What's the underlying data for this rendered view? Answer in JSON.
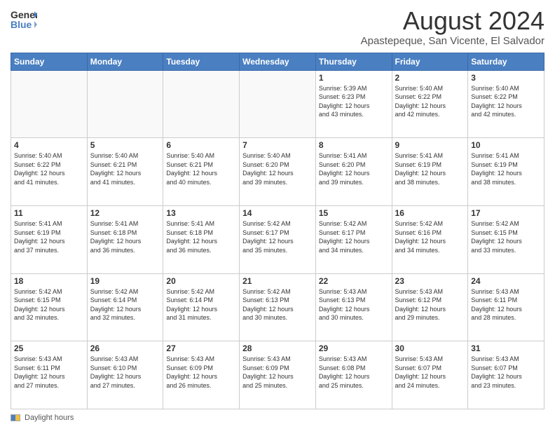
{
  "logo": {
    "line1": "General",
    "line2": "Blue"
  },
  "title": "August 2024",
  "location": "Apastepeque, San Vicente, El Salvador",
  "days_of_week": [
    "Sunday",
    "Monday",
    "Tuesday",
    "Wednesday",
    "Thursday",
    "Friday",
    "Saturday"
  ],
  "footer": {
    "label": "Daylight hours"
  },
  "weeks": [
    [
      {
        "day": "",
        "info": ""
      },
      {
        "day": "",
        "info": ""
      },
      {
        "day": "",
        "info": ""
      },
      {
        "day": "",
        "info": ""
      },
      {
        "day": "1",
        "info": "Sunrise: 5:39 AM\nSunset: 6:23 PM\nDaylight: 12 hours\nand 43 minutes."
      },
      {
        "day": "2",
        "info": "Sunrise: 5:40 AM\nSunset: 6:22 PM\nDaylight: 12 hours\nand 42 minutes."
      },
      {
        "day": "3",
        "info": "Sunrise: 5:40 AM\nSunset: 6:22 PM\nDaylight: 12 hours\nand 42 minutes."
      }
    ],
    [
      {
        "day": "4",
        "info": "Sunrise: 5:40 AM\nSunset: 6:22 PM\nDaylight: 12 hours\nand 41 minutes."
      },
      {
        "day": "5",
        "info": "Sunrise: 5:40 AM\nSunset: 6:21 PM\nDaylight: 12 hours\nand 41 minutes."
      },
      {
        "day": "6",
        "info": "Sunrise: 5:40 AM\nSunset: 6:21 PM\nDaylight: 12 hours\nand 40 minutes."
      },
      {
        "day": "7",
        "info": "Sunrise: 5:40 AM\nSunset: 6:20 PM\nDaylight: 12 hours\nand 39 minutes."
      },
      {
        "day": "8",
        "info": "Sunrise: 5:41 AM\nSunset: 6:20 PM\nDaylight: 12 hours\nand 39 minutes."
      },
      {
        "day": "9",
        "info": "Sunrise: 5:41 AM\nSunset: 6:19 PM\nDaylight: 12 hours\nand 38 minutes."
      },
      {
        "day": "10",
        "info": "Sunrise: 5:41 AM\nSunset: 6:19 PM\nDaylight: 12 hours\nand 38 minutes."
      }
    ],
    [
      {
        "day": "11",
        "info": "Sunrise: 5:41 AM\nSunset: 6:19 PM\nDaylight: 12 hours\nand 37 minutes."
      },
      {
        "day": "12",
        "info": "Sunrise: 5:41 AM\nSunset: 6:18 PM\nDaylight: 12 hours\nand 36 minutes."
      },
      {
        "day": "13",
        "info": "Sunrise: 5:41 AM\nSunset: 6:18 PM\nDaylight: 12 hours\nand 36 minutes."
      },
      {
        "day": "14",
        "info": "Sunrise: 5:42 AM\nSunset: 6:17 PM\nDaylight: 12 hours\nand 35 minutes."
      },
      {
        "day": "15",
        "info": "Sunrise: 5:42 AM\nSunset: 6:17 PM\nDaylight: 12 hours\nand 34 minutes."
      },
      {
        "day": "16",
        "info": "Sunrise: 5:42 AM\nSunset: 6:16 PM\nDaylight: 12 hours\nand 34 minutes."
      },
      {
        "day": "17",
        "info": "Sunrise: 5:42 AM\nSunset: 6:15 PM\nDaylight: 12 hours\nand 33 minutes."
      }
    ],
    [
      {
        "day": "18",
        "info": "Sunrise: 5:42 AM\nSunset: 6:15 PM\nDaylight: 12 hours\nand 32 minutes."
      },
      {
        "day": "19",
        "info": "Sunrise: 5:42 AM\nSunset: 6:14 PM\nDaylight: 12 hours\nand 32 minutes."
      },
      {
        "day": "20",
        "info": "Sunrise: 5:42 AM\nSunset: 6:14 PM\nDaylight: 12 hours\nand 31 minutes."
      },
      {
        "day": "21",
        "info": "Sunrise: 5:42 AM\nSunset: 6:13 PM\nDaylight: 12 hours\nand 30 minutes."
      },
      {
        "day": "22",
        "info": "Sunrise: 5:43 AM\nSunset: 6:13 PM\nDaylight: 12 hours\nand 30 minutes."
      },
      {
        "day": "23",
        "info": "Sunrise: 5:43 AM\nSunset: 6:12 PM\nDaylight: 12 hours\nand 29 minutes."
      },
      {
        "day": "24",
        "info": "Sunrise: 5:43 AM\nSunset: 6:11 PM\nDaylight: 12 hours\nand 28 minutes."
      }
    ],
    [
      {
        "day": "25",
        "info": "Sunrise: 5:43 AM\nSunset: 6:11 PM\nDaylight: 12 hours\nand 27 minutes."
      },
      {
        "day": "26",
        "info": "Sunrise: 5:43 AM\nSunset: 6:10 PM\nDaylight: 12 hours\nand 27 minutes."
      },
      {
        "day": "27",
        "info": "Sunrise: 5:43 AM\nSunset: 6:09 PM\nDaylight: 12 hours\nand 26 minutes."
      },
      {
        "day": "28",
        "info": "Sunrise: 5:43 AM\nSunset: 6:09 PM\nDaylight: 12 hours\nand 25 minutes."
      },
      {
        "day": "29",
        "info": "Sunrise: 5:43 AM\nSunset: 6:08 PM\nDaylight: 12 hours\nand 25 minutes."
      },
      {
        "day": "30",
        "info": "Sunrise: 5:43 AM\nSunset: 6:07 PM\nDaylight: 12 hours\nand 24 minutes."
      },
      {
        "day": "31",
        "info": "Sunrise: 5:43 AM\nSunset: 6:07 PM\nDaylight: 12 hours\nand 23 minutes."
      }
    ]
  ]
}
